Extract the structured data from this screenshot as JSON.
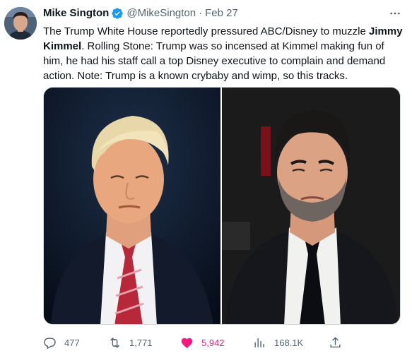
{
  "author": {
    "name": "Mike Sington",
    "handle": "@MikeSington",
    "separator": "·",
    "date": "Feb 27",
    "verified": true
  },
  "tweet": {
    "text_part1": "The Trump White House reportedly pressured ABC/Disney to muzzle ",
    "text_bold": "Jimmy Kimmel",
    "text_part2": ". Rolling Stone: Trump was so incensed at Kimmel making fun of him, he had his staff call a top Disney executive to complain and demand action. Note: Trump is a known crybaby and wimp, so this tracks."
  },
  "media": {
    "left_photo": "portrait-photo",
    "right_photo": "portrait-photo"
  },
  "actions": {
    "replies": "477",
    "retweets": "1,771",
    "likes": "5,942",
    "views": "168.1K"
  },
  "colors": {
    "verified_blue": "#1d9bf0",
    "like_pink": "#f91880",
    "secondary_text": "#536471"
  },
  "icons": [
    "more-icon",
    "verified-icon",
    "reply-icon",
    "retweet-icon",
    "like-icon",
    "views-icon",
    "share-icon"
  ]
}
